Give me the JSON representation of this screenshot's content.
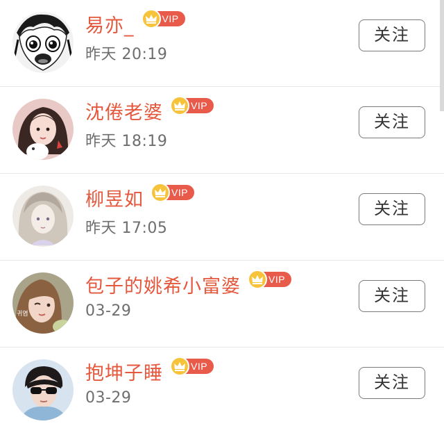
{
  "follow_label": "关注",
  "vip_label": "VIP",
  "icons": {
    "avatar": "avatar-image",
    "vip": "crown-icon"
  },
  "colors": {
    "name": "#e4583d",
    "vip_badge": "#e85a4a",
    "crown": "#f7c33b",
    "time": "#6e6e6e"
  },
  "users": [
    {
      "name": "易亦_",
      "time": "昨天 20:19"
    },
    {
      "name": "沈倦老婆",
      "time": "昨天 18:19"
    },
    {
      "name": "柳昱如",
      "time": "昨天 17:05"
    },
    {
      "name": "包子的姚希小富婆",
      "time": "03-29"
    },
    {
      "name": "抱坤子睡",
      "time": "03-29"
    }
  ]
}
